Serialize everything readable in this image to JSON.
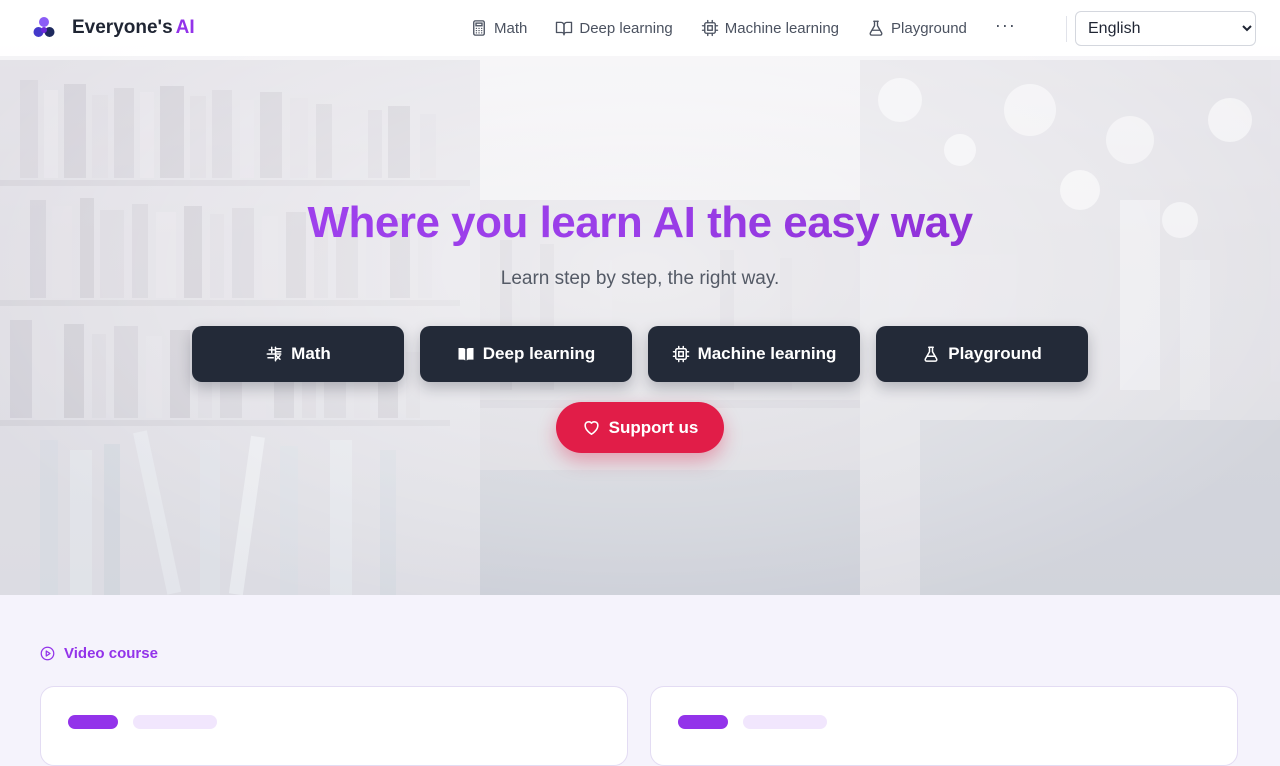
{
  "brand": {
    "name": "Everyone's",
    "accent": "AI",
    "accent_color": "#9333ea"
  },
  "nav": {
    "items": [
      {
        "label": "Math",
        "icon": "calculator-icon"
      },
      {
        "label": "Deep learning",
        "icon": "book-open-icon"
      },
      {
        "label": "Machine learning",
        "icon": "cpu-icon"
      },
      {
        "label": "Playground",
        "icon": "flask-icon"
      }
    ],
    "more_label": "···",
    "language": {
      "selected": "English"
    }
  },
  "hero": {
    "title": "Where you learn AI the easy way",
    "subtitle": "Learn step by step, the right way.",
    "buttons": [
      {
        "label": "Math",
        "icon": "math-symbols-icon"
      },
      {
        "label": "Deep learning",
        "icon": "book-icon"
      },
      {
        "label": "Machine learning",
        "icon": "cpu-icon"
      },
      {
        "label": "Playground",
        "icon": "flask-icon"
      }
    ],
    "support": {
      "label": "Support us",
      "icon": "heart-icon",
      "color": "#e11d48"
    }
  },
  "section": {
    "label": "Video course",
    "icon": "play-circle-icon"
  },
  "colors": {
    "button_dark": "#232a38",
    "accent": "#9333ea",
    "page_bg": "#f5f3fc"
  }
}
